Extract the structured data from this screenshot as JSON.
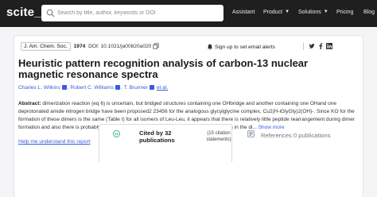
{
  "nav": {
    "logo": "scite_",
    "search_placeholder": "Search by title, author, keywords or DOI",
    "items": [
      {
        "label": "Assistant",
        "dropdown": false
      },
      {
        "label": "Product",
        "dropdown": true
      },
      {
        "label": "Solutions",
        "dropdown": true
      },
      {
        "label": "Pricing",
        "dropdown": false
      },
      {
        "label": "Blog",
        "dropdown": false
      }
    ]
  },
  "article": {
    "journal": "J. Am. Chem. Soc.",
    "year": "1974",
    "doi": "DOI: 10.1021/ja00820a020",
    "signup_label": "Sign up to set email alerts",
    "title": "Heuristic pattern recognition analysis of carbon-13 nuclear magnetic resonance spectra",
    "authors": [
      "Charles L. Wilkins",
      "Robert C. Williams",
      "T. Brunner"
    ],
    "et_al": "et al.",
    "abstract_label": "Abstract:",
    "abstract_text": "dimerization reaction (eq 6) is uncertain, but bridged structures containing one OHbridge and another containing one OHand one deprotonated amide nitrogen bridge have been proposed2 23456 for the analogous glycylglycine complex, Cu2(H-iGlyGly)2(OH)-. Since KO for the formation of these dimers is the same (Table I) for all isomers of Leu-Leu, it appears that there is relatively little peptide rearrangement during dimer formation and also there is probably little contact in the dimer between the two peptide ligands in the di...",
    "show_more": "Show more",
    "help_link": "Help me understand this report"
  },
  "tabs": {
    "cited_by": "Cited by 32 publications",
    "cited_sub": "(15 citation statements)",
    "references": "References 0 publications"
  },
  "colors": {
    "nav_bg": "#1f1f1f",
    "link": "#3b5bdb",
    "accent_green": "#2bb673"
  },
  "icons": {
    "search": "search-icon",
    "bell": "bell-icon",
    "twitter": "twitter-icon",
    "facebook": "facebook-icon",
    "linkedin": "linkedin-icon",
    "quote": "quote-icon",
    "references": "references-icon"
  }
}
